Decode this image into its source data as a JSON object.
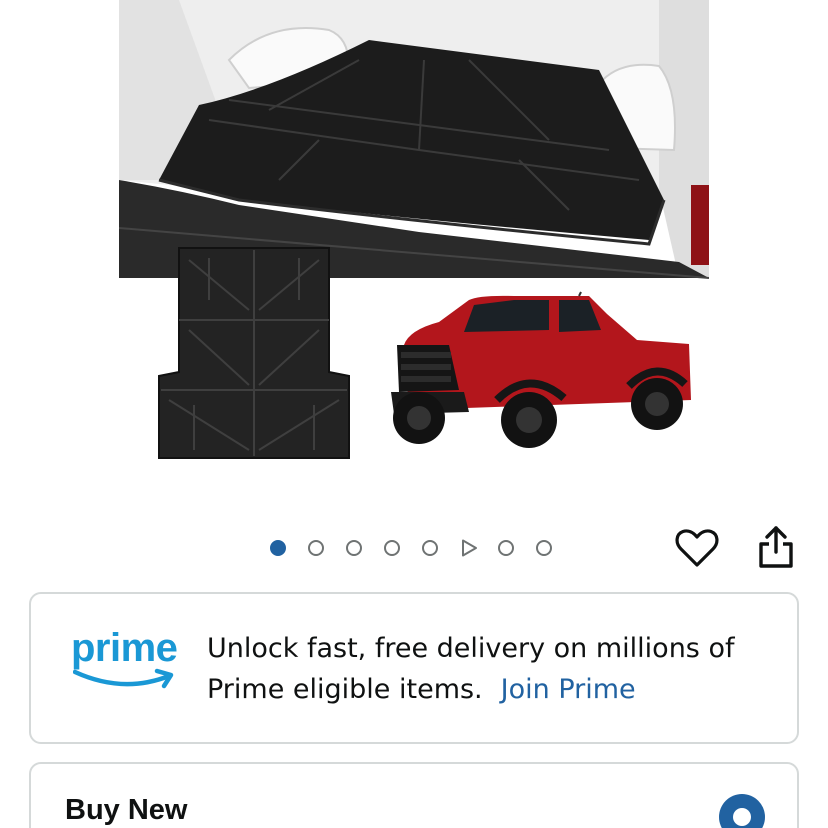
{
  "gallery": {
    "total_slides": 8,
    "active_index": 0,
    "video_slide_index": 5
  },
  "icons": {
    "wishlist": "heart-icon",
    "share": "share-icon",
    "video": "play-icon"
  },
  "prime": {
    "logo_text": "prime",
    "message": "Unlock fast, free delivery on millions of Prime eligible items.",
    "cta": "Join Prime"
  },
  "buy": {
    "title": "Buy New",
    "selected": true
  },
  "colors": {
    "accent_blue": "#2162a1",
    "prime_blue": "#1a98d5",
    "card_border": "#d5d9d9",
    "truck_red": "#b3161c"
  }
}
